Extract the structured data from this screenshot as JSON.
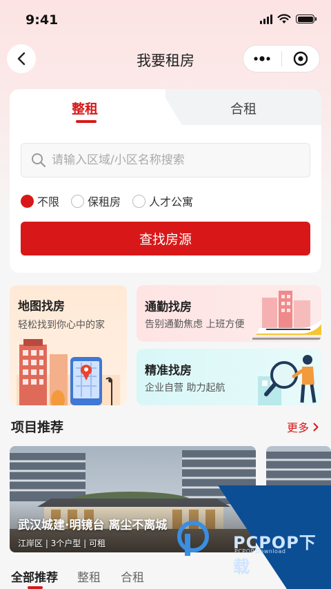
{
  "status_bar": {
    "time": "9:41"
  },
  "nav": {
    "title": "我要租房"
  },
  "search_card": {
    "tabs": [
      {
        "label": "整租",
        "active": true
      },
      {
        "label": "合租",
        "active": false
      }
    ],
    "search": {
      "placeholder": "请输入区域/小区名称搜索",
      "value": ""
    },
    "radios": [
      {
        "label": "不限",
        "checked": true
      },
      {
        "label": "保租房",
        "checked": false
      },
      {
        "label": "人才公寓",
        "checked": false
      }
    ],
    "find_button": "查找房源"
  },
  "features": {
    "map": {
      "title": "地图找房",
      "subtitle": "轻松找到你心中的家"
    },
    "commute": {
      "title": "通勤找房",
      "subtitle": "告别通勤焦虑  上班方便"
    },
    "exact": {
      "title": "精准找房",
      "subtitle": "企业自营  助力起航"
    }
  },
  "section": {
    "title": "项目推荐",
    "more": "更多"
  },
  "projects": [
    {
      "name": "武汉城建·明镜台  离尘不离城",
      "meta": "江岸区 | 3个户型 | 可租"
    }
  ],
  "bottom_tabs": [
    {
      "label": "全部推荐",
      "active": true
    },
    {
      "label": "整租",
      "active": false
    },
    {
      "label": "合租",
      "active": false
    }
  ],
  "watermark": {
    "brand": "PCPOP下载",
    "url": "PCPOP.Download"
  },
  "colors": {
    "accent": "#d81818",
    "header_gradient": "#fde3e3",
    "watermark_blue": "#0b4e94"
  }
}
